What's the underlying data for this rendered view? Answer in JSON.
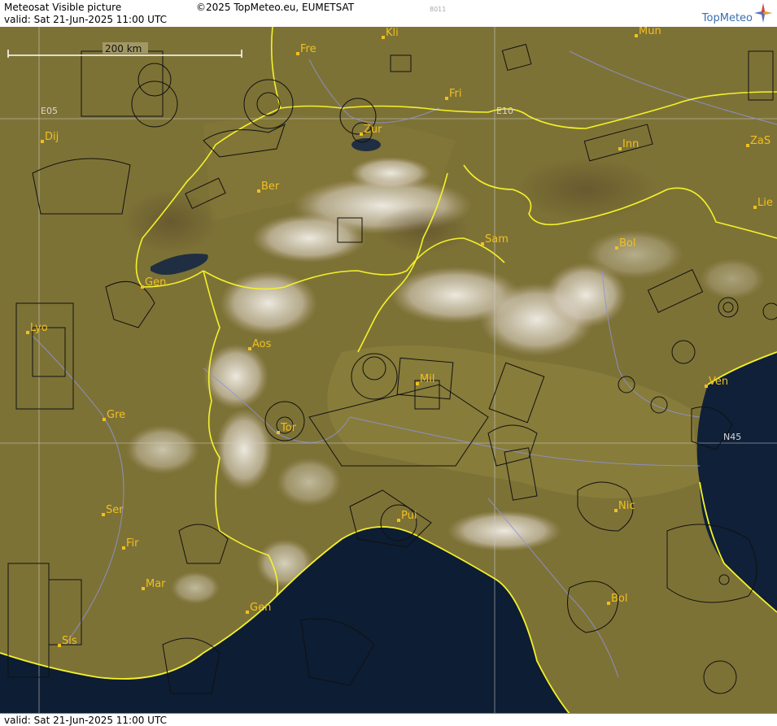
{
  "header": {
    "title": "Meteosat Visible picture",
    "valid": "valid:  Sat  21-Jun-2025  11:00 UTC",
    "copyright": "©2025 TopMeteo.eu, EUMETSAT",
    "image_id": "8011",
    "brand": "TopMeteo"
  },
  "footer": {
    "valid": "valid:  Sat  21-Jun-2025  11:00 UTC"
  },
  "scale": {
    "label": "200 km"
  },
  "grid_labels": [
    "E05",
    "E10",
    "N45"
  ],
  "cities": [
    "Fre",
    "Kli",
    "Mun",
    "Fri",
    "Dij",
    "Zur",
    "Inn",
    "ZaS",
    "Ber",
    "Lie",
    "Sam",
    "Bol",
    "Gen",
    "Lyo",
    "Aos",
    "Mil",
    "Ven",
    "Gre",
    "Tor",
    "Ser",
    "Gen",
    "Bol",
    "Sis",
    "Pui",
    "Nic",
    "Fir",
    "Mar"
  ],
  "colors": {
    "land": "#7d7236",
    "lowland": "#8a7e3c",
    "sea": "#0d1d33",
    "border": "#f4f22a",
    "label": "#f0c020",
    "airspace": "#111111",
    "rivers": "#8f93d8",
    "cloud": "#e9e6e0",
    "grid": "#d0d0d0"
  }
}
